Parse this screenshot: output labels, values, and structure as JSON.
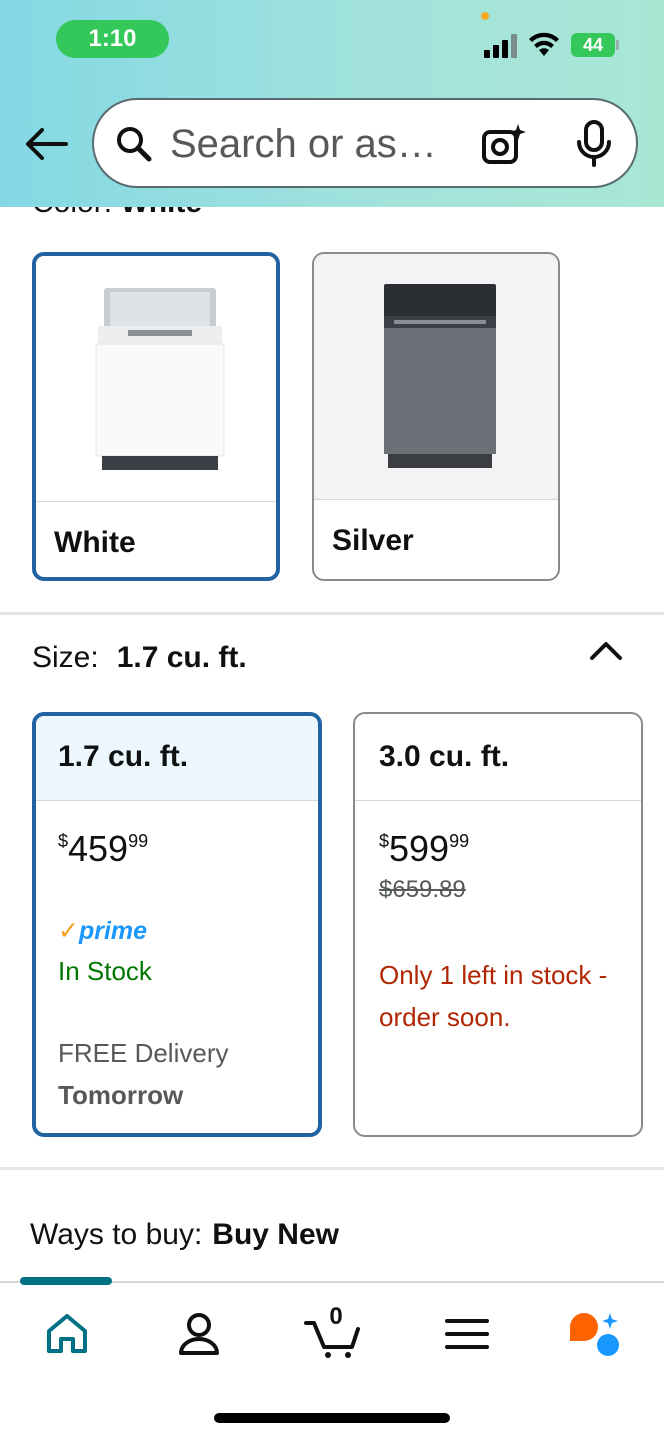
{
  "status_bar": {
    "time": "1:10",
    "battery": "44"
  },
  "header": {
    "search_placeholder": "Search or as…",
    "icons": [
      "back-arrow-icon",
      "search-icon",
      "camera-icon",
      "microphone-icon"
    ]
  },
  "color_section": {
    "label": "Color:",
    "value": "White",
    "options": [
      {
        "label": "White",
        "selected": true
      },
      {
        "label": "Silver",
        "selected": false
      }
    ]
  },
  "size_section": {
    "label": "Size:",
    "value": "1.7 cu. ft.",
    "options": [
      {
        "label": "1.7 cu. ft.",
        "currency": "$",
        "price_whole": "459",
        "price_cents": "99",
        "badge": "prime",
        "stock": "In Stock",
        "delivery": "FREE Delivery",
        "delivery_day": "Tomorrow",
        "selected": true
      },
      {
        "label": "3.0 cu. ft.",
        "currency": "$",
        "price_whole": "599",
        "price_cents": "99",
        "list_price": "$659.89",
        "stock": "Only 1 left in stock - order soon.",
        "selected": false
      }
    ]
  },
  "ways_to_buy": {
    "label": "Ways to buy:",
    "value": "Buy New"
  },
  "bottom_nav": {
    "items": [
      "home-icon",
      "account-icon",
      "cart-icon",
      "menu-icon",
      "rufus-ai-icon"
    ],
    "cart_count": "0",
    "active": "home"
  },
  "colors": {
    "accent_selected_border": "#2162a1",
    "in_stock_green": "#007600",
    "low_stock_red": "#b12704",
    "prime_blue": "#1a98ff",
    "nav_teal": "#007185"
  }
}
